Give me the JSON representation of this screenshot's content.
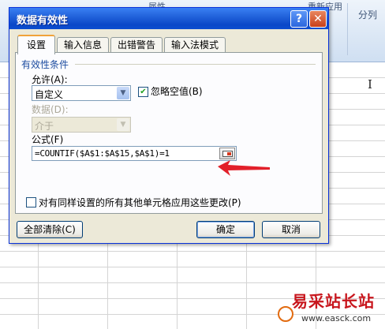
{
  "background": {
    "ribbon_items": [
      "属性",
      "重新应用",
      "分列"
    ],
    "cursor_glyph": "I"
  },
  "dialog": {
    "title": "数据有效性",
    "help_glyph": "?",
    "close_glyph": "✕",
    "tabs": [
      {
        "label": "设置",
        "active": true
      },
      {
        "label": "输入信息",
        "active": false
      },
      {
        "label": "出错警告",
        "active": false
      },
      {
        "label": "输入法模式",
        "active": false
      }
    ],
    "group_label": "有效性条件",
    "allow_label": "允许(A):",
    "allow_value": "自定义",
    "ignore_blank_label": "忽略空值(B)",
    "ignore_blank_checked": true,
    "data_label": "数据(D):",
    "data_value": "介于",
    "formula_label": "公式(F)",
    "formula_value": "=COUNTIF($A$1:$A$15,$A$1)=1",
    "apply_all_label": "对有同样设置的所有其他单元格应用这些更改(P)",
    "apply_all_checked": false,
    "clear_all_label": "全部清除(C)",
    "ok_label": "确定",
    "cancel_label": "取消"
  },
  "watermark": {
    "text": "易采站长站",
    "url": "www.easck.com"
  },
  "colors": {
    "title_bar": "#0a47c8",
    "arrow": "#e2202a",
    "watermark": "#c8161d"
  }
}
